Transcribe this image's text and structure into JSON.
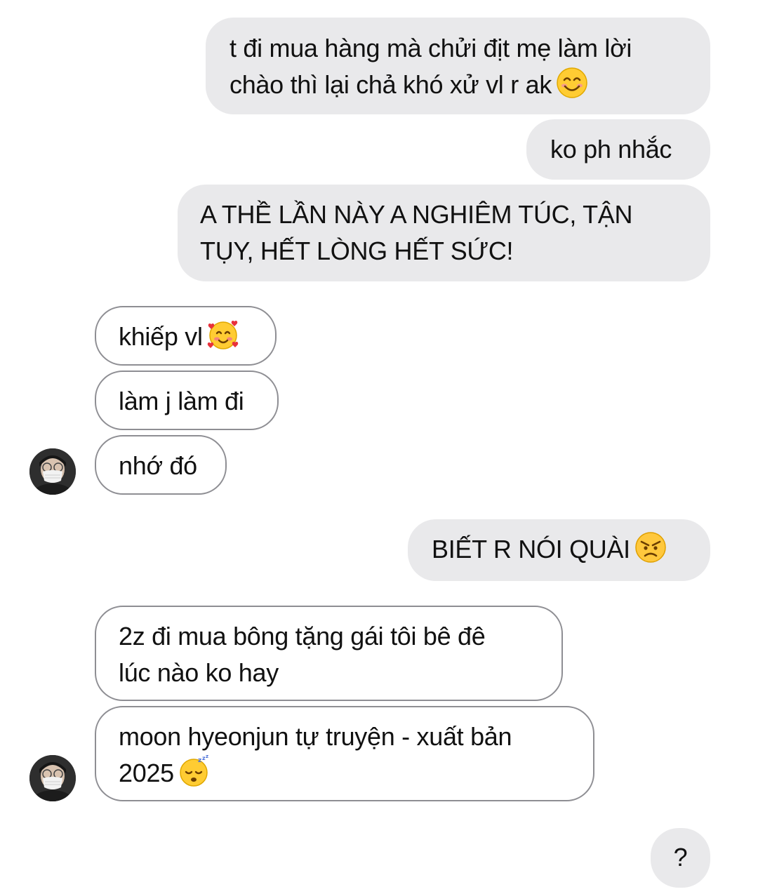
{
  "messages": {
    "m1": {
      "line1": "t đi mua hàng mà chửi địt mẹ làm lời",
      "line2": "chào thì lại chả khó xử vl r ak",
      "emoji": "smiling-face-emoji"
    },
    "m2": {
      "text": "ko ph nhắc"
    },
    "m3": {
      "line1": "A THỀ LẦN NÀY A NGHIÊM TÚC, TẬN",
      "line2": "TỤY, HẾT LÒNG HẾT SỨC!"
    },
    "m4": {
      "text": "khiếp vl",
      "emoji": "smiling-face-with-hearts-emoji"
    },
    "m5": {
      "text": "làm j làm đi"
    },
    "m6": {
      "text": "nhớ đó"
    },
    "m7": {
      "text": "BIẾT R NÓI QUÀI",
      "emoji": "angry-face-emoji"
    },
    "m8": {
      "line1": "2z đi mua bông tặng gái tôi bê đê",
      "line2": "lúc nào ko hay"
    },
    "m9": {
      "line1": "moon hyeonjun tự truyện - xuất bản",
      "line2": "2025",
      "emoji": "sleeping-face-emoji"
    },
    "m10": {
      "text": "?"
    }
  },
  "colors": {
    "outgoing_bubble": "#e9e9eb",
    "incoming_border": "#8e8e93",
    "text": "#111111"
  }
}
